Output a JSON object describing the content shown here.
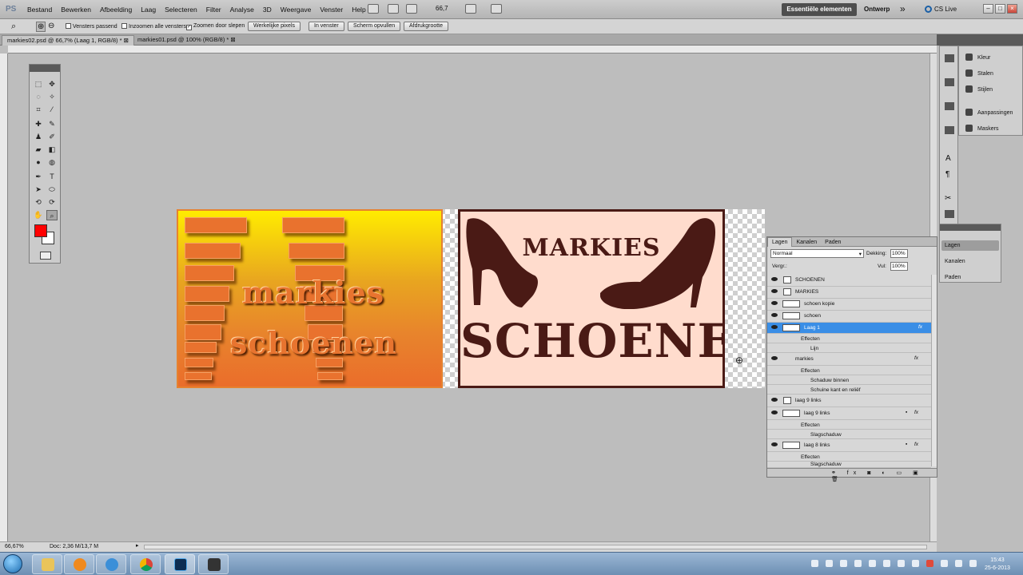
{
  "app": {
    "logo": "PS"
  },
  "menu": [
    "Bestand",
    "Bewerken",
    "Afbeelding",
    "Laag",
    "Selecteren",
    "Filter",
    "Analyse",
    "3D",
    "Weergave",
    "Venster",
    "Help"
  ],
  "zoom_value": "66,7",
  "workspace": {
    "active": "Essentiële elementen",
    "other": "Ontwerp",
    "more": "»",
    "cslive": "CS Live"
  },
  "options": {
    "fit_windows": "Vensters passend",
    "zoom_all": "Inzoomen alle vensters",
    "zoom_drag": "Zoomen door slepen",
    "actual_pixels": "Werkelijke pixels",
    "in_window": "In venster",
    "fill_screen": "Scherm opvullen",
    "print_size": "Afdrukgrootte"
  },
  "tabs": [
    {
      "label": "markies02.psd @ 66,7% (Laag 1, RGB/8) *"
    },
    {
      "label": "markies01.psd @ 100% (RGB/8) *"
    }
  ],
  "canvas": {
    "left_text1": "markies",
    "left_text2": "schoenen",
    "right_title": "MARKIES",
    "right_main": "SCHOENEN"
  },
  "status": {
    "zoom": "66,67%",
    "doc": "Doc: 2,36 M/13,7 M"
  },
  "dock": {
    "items": [
      "Kleur",
      "Stalen",
      "Stijlen",
      "Aanpassingen",
      "Maskers"
    ]
  },
  "mini_layers": [
    "Lagen",
    "Kanalen",
    "Paden"
  ],
  "layers_panel": {
    "tabs": [
      "Lagen",
      "Kanalen",
      "Paden"
    ],
    "blend_mode": "Normaal",
    "opacity_label": "Dekking:",
    "opacity": "100%",
    "lock_label": "Vergr.:",
    "fill_label": "Vul:",
    "fill": "100%",
    "rows": [
      "SCHOENEN",
      "MARKIES",
      "schoen kopie",
      "schoen",
      "Laag 1",
      "Effecten",
      "Lijn",
      "markies",
      "Effecten",
      "Schaduw binnen",
      "Schuine kant en reliëf",
      "laag 9 links",
      "laag 9 links",
      "Effecten",
      "Slagschaduw",
      "laag 8 links",
      "Effecten",
      "Slagschaduw"
    ]
  },
  "taskbar": {
    "time": "15:43",
    "date": "25-6-2013"
  },
  "colors": {
    "foreground": "#ff0000",
    "background": "#ffffff",
    "selection": "#3a8ee6"
  }
}
